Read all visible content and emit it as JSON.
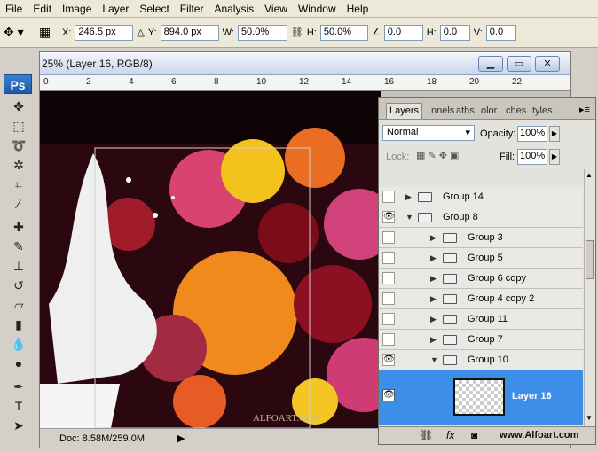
{
  "menu": [
    "File",
    "Edit",
    "Image",
    "Layer",
    "Select",
    "Filter",
    "Analysis",
    "View",
    "Window",
    "Help"
  ],
  "options": {
    "x_label": "X:",
    "x_value": "246.5 px",
    "y_label": "Y:",
    "y_value": "894.0 px",
    "w_label": "W:",
    "w_value": "50.0%",
    "h_label": "H:",
    "h_value": "50.0%",
    "angle_value": "0.0",
    "hskew_label": "H:",
    "hskew_value": "0.0",
    "vskew_label": "V:",
    "vskew_value": "0.0"
  },
  "app_logo": "Ps",
  "document": {
    "title": "25% (Layer 16, RGB/8)",
    "ruler_ticks": [
      "0",
      "2",
      "4",
      "6",
      "8",
      "10",
      "12",
      "14",
      "16",
      "18",
      "20",
      "22"
    ],
    "status": "Doc: 8.58M/259.0M",
    "watermark": "ALFOART.COM"
  },
  "layers_panel": {
    "tabs": [
      "Layers",
      "nnels",
      "aths",
      "olor",
      "ches",
      "tyles"
    ],
    "blend_mode": "Normal",
    "opacity_label": "Opacity:",
    "opacity_value": "100%",
    "lock_label": "Lock:",
    "fill_label": "Fill:",
    "fill_value": "100%",
    "rows": [
      {
        "name": "Group 14",
        "visible": false,
        "expanded": false
      },
      {
        "name": "Group 8",
        "visible": true,
        "expanded": true
      },
      {
        "name": "Group 3",
        "visible": false,
        "expanded": false
      },
      {
        "name": "Group 5",
        "visible": false,
        "expanded": false
      },
      {
        "name": "Group 6 copy",
        "visible": false,
        "expanded": false
      },
      {
        "name": "Group 4 copy 2",
        "visible": false,
        "expanded": false
      },
      {
        "name": "Group 11",
        "visible": false,
        "expanded": false
      },
      {
        "name": "Group 7",
        "visible": false,
        "expanded": false
      },
      {
        "name": "Group 10",
        "visible": true,
        "expanded": true
      }
    ],
    "selected_layer": "Layer 16"
  },
  "site_credit": "www.Alfoart.com",
  "colors": {
    "selection": "#3d8ee8",
    "ps_blue": "#1e5aa8"
  }
}
